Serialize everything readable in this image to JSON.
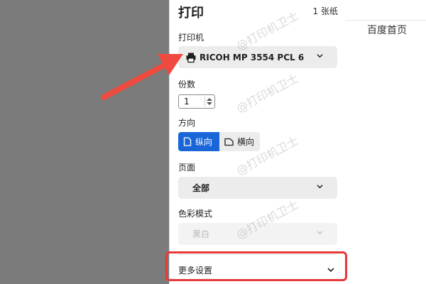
{
  "background_page": {
    "nav_link": "百度首页"
  },
  "print_dialog": {
    "title": "打印",
    "sheet_count": "1 张纸",
    "printer": {
      "label": "打印机",
      "selected": "RICOH MP 3554 PCL 6",
      "icon": "printer-icon"
    },
    "copies": {
      "label": "份数",
      "value": "1"
    },
    "orientation": {
      "label": "方向",
      "options": [
        "纵向",
        "横向"
      ],
      "selected": "纵向"
    },
    "pages": {
      "label": "页面",
      "selected": "全部"
    },
    "color_mode": {
      "label": "色彩模式",
      "selected": "黑白",
      "disabled": true
    },
    "more_settings": {
      "label": "更多设置"
    }
  },
  "annotation": {
    "highlight_color": "#e63a3a",
    "arrow_color": "#ee4a3f"
  },
  "watermark_text": "@打印机卫士",
  "colors": {
    "accent": "#1a66d9",
    "overlay": "#7b7b7b"
  }
}
